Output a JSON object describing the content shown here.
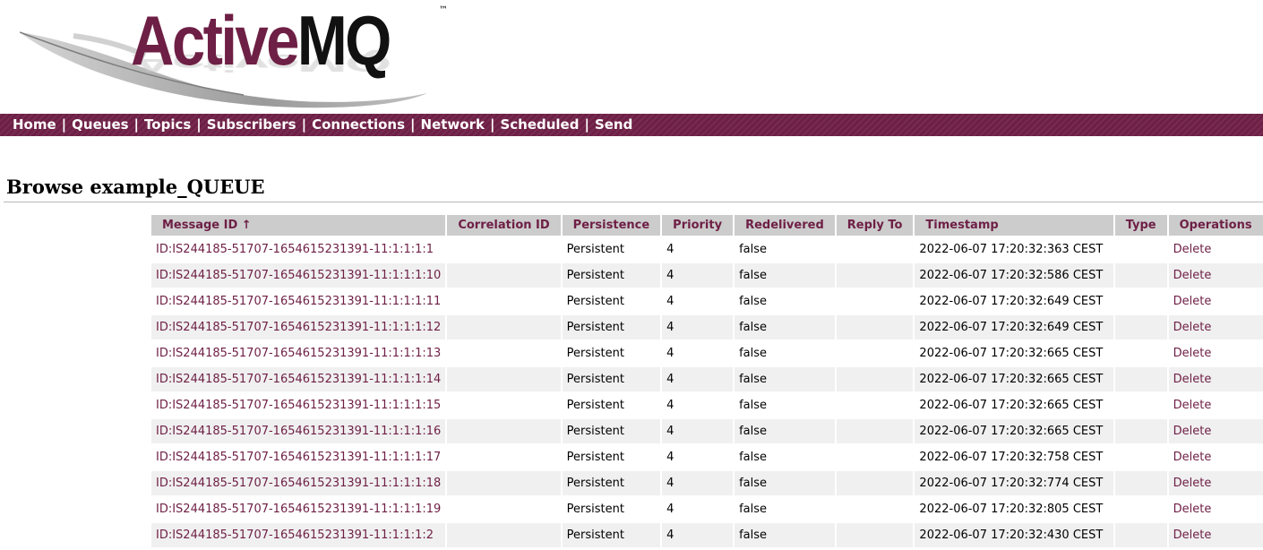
{
  "logo": {
    "text_active": "Active",
    "text_mq": "MQ",
    "trademark": "™"
  },
  "nav": [
    {
      "label": "Home"
    },
    {
      "label": "Queues"
    },
    {
      "label": "Topics"
    },
    {
      "label": "Subscribers"
    },
    {
      "label": "Connections"
    },
    {
      "label": "Network"
    },
    {
      "label": "Scheduled"
    },
    {
      "label": "Send"
    }
  ],
  "nav_separator": "|",
  "page": {
    "title": "Browse example_QUEUE"
  },
  "table": {
    "columns": [
      "Message ID ↑",
      "Correlation ID",
      "Persistence",
      "Priority",
      "Redelivered",
      "Reply To",
      "Timestamp",
      "Type",
      "Operations"
    ],
    "rows": [
      {
        "id": "ID:IS244185-51707-1654615231391-11:1:1:1:1",
        "correlation": "",
        "persistence": "Persistent",
        "priority": "4",
        "redelivered": "false",
        "reply_to": "",
        "timestamp": "2022-06-07 17:20:32:363 CEST",
        "type": "",
        "operation": "Delete"
      },
      {
        "id": "ID:IS244185-51707-1654615231391-11:1:1:1:10",
        "correlation": "",
        "persistence": "Persistent",
        "priority": "4",
        "redelivered": "false",
        "reply_to": "",
        "timestamp": "2022-06-07 17:20:32:586 CEST",
        "type": "",
        "operation": "Delete"
      },
      {
        "id": "ID:IS244185-51707-1654615231391-11:1:1:1:11",
        "correlation": "",
        "persistence": "Persistent",
        "priority": "4",
        "redelivered": "false",
        "reply_to": "",
        "timestamp": "2022-06-07 17:20:32:649 CEST",
        "type": "",
        "operation": "Delete"
      },
      {
        "id": "ID:IS244185-51707-1654615231391-11:1:1:1:12",
        "correlation": "",
        "persistence": "Persistent",
        "priority": "4",
        "redelivered": "false",
        "reply_to": "",
        "timestamp": "2022-06-07 17:20:32:649 CEST",
        "type": "",
        "operation": "Delete"
      },
      {
        "id": "ID:IS244185-51707-1654615231391-11:1:1:1:13",
        "correlation": "",
        "persistence": "Persistent",
        "priority": "4",
        "redelivered": "false",
        "reply_to": "",
        "timestamp": "2022-06-07 17:20:32:665 CEST",
        "type": "",
        "operation": "Delete"
      },
      {
        "id": "ID:IS244185-51707-1654615231391-11:1:1:1:14",
        "correlation": "",
        "persistence": "Persistent",
        "priority": "4",
        "redelivered": "false",
        "reply_to": "",
        "timestamp": "2022-06-07 17:20:32:665 CEST",
        "type": "",
        "operation": "Delete"
      },
      {
        "id": "ID:IS244185-51707-1654615231391-11:1:1:1:15",
        "correlation": "",
        "persistence": "Persistent",
        "priority": "4",
        "redelivered": "false",
        "reply_to": "",
        "timestamp": "2022-06-07 17:20:32:665 CEST",
        "type": "",
        "operation": "Delete"
      },
      {
        "id": "ID:IS244185-51707-1654615231391-11:1:1:1:16",
        "correlation": "",
        "persistence": "Persistent",
        "priority": "4",
        "redelivered": "false",
        "reply_to": "",
        "timestamp": "2022-06-07 17:20:32:665 CEST",
        "type": "",
        "operation": "Delete"
      },
      {
        "id": "ID:IS244185-51707-1654615231391-11:1:1:1:17",
        "correlation": "",
        "persistence": "Persistent",
        "priority": "4",
        "redelivered": "false",
        "reply_to": "",
        "timestamp": "2022-06-07 17:20:32:758 CEST",
        "type": "",
        "operation": "Delete"
      },
      {
        "id": "ID:IS244185-51707-1654615231391-11:1:1:1:18",
        "correlation": "",
        "persistence": "Persistent",
        "priority": "4",
        "redelivered": "false",
        "reply_to": "",
        "timestamp": "2022-06-07 17:20:32:774 CEST",
        "type": "",
        "operation": "Delete"
      },
      {
        "id": "ID:IS244185-51707-1654615231391-11:1:1:1:19",
        "correlation": "",
        "persistence": "Persistent",
        "priority": "4",
        "redelivered": "false",
        "reply_to": "",
        "timestamp": "2022-06-07 17:20:32:805 CEST",
        "type": "",
        "operation": "Delete"
      },
      {
        "id": "ID:IS244185-51707-1654615231391-11:1:1:1:2",
        "correlation": "",
        "persistence": "Persistent",
        "priority": "4",
        "redelivered": "false",
        "reply_to": "",
        "timestamp": "2022-06-07 17:20:32:430 CEST",
        "type": "",
        "operation": "Delete"
      }
    ]
  },
  "colors": {
    "brand": "#6e1f45",
    "header_bg": "#cccccc",
    "row_alt": "#f0f0f0"
  }
}
